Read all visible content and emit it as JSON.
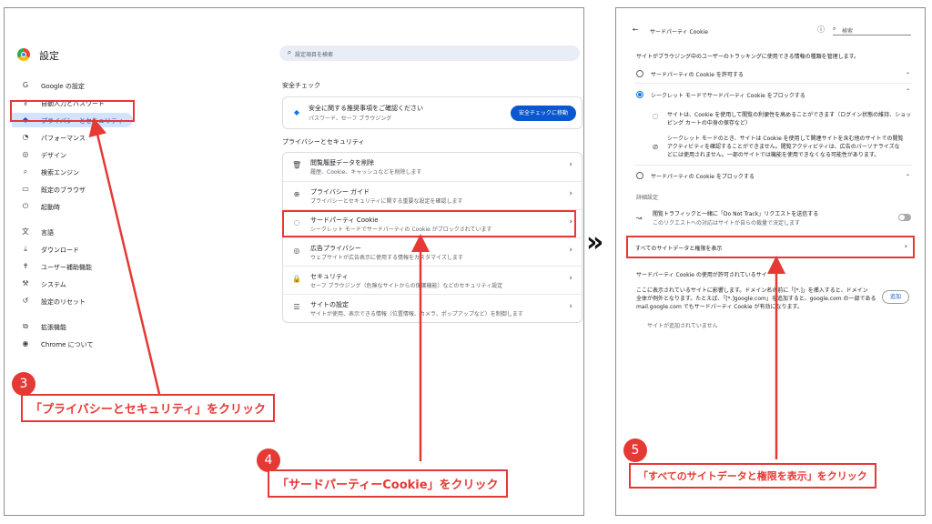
{
  "left": {
    "title": "設定",
    "search_placeholder": "設定項目を検索",
    "nav": [
      {
        "label": "Google の設定",
        "icon": "google-icon",
        "glyph": "G"
      },
      {
        "label": "自動入力とパスワード",
        "icon": "key-icon",
        "glyph": "⚷"
      },
      {
        "label": "プライバシーとセキュリティ",
        "icon": "shield-icon",
        "glyph": "◆"
      },
      {
        "label": "パフォーマンス",
        "icon": "gauge-icon",
        "glyph": "◔"
      },
      {
        "label": "デザイン",
        "icon": "palette-icon",
        "glyph": "◎"
      },
      {
        "label": "検索エンジン",
        "icon": "search-icon",
        "glyph": "⌕"
      },
      {
        "label": "既定のブラウザ",
        "icon": "browser-icon",
        "glyph": "▭"
      },
      {
        "label": "起動時",
        "icon": "power-icon",
        "glyph": "⏻"
      },
      {
        "label": "言語",
        "icon": "translate-icon",
        "glyph": "文"
      },
      {
        "label": "ダウンロード",
        "icon": "download-icon",
        "glyph": "⤓"
      },
      {
        "label": "ユーザー補助機能",
        "icon": "accessibility-icon",
        "glyph": "✝"
      },
      {
        "label": "システム",
        "icon": "wrench-icon",
        "glyph": "⚒"
      },
      {
        "label": "設定のリセット",
        "icon": "reset-icon",
        "glyph": "↺"
      },
      {
        "label": "拡張機能",
        "icon": "extension-icon",
        "glyph": "⧉"
      },
      {
        "label": "Chrome について",
        "icon": "chrome-icon",
        "glyph": "◉"
      }
    ],
    "safety_heading": "安全チェック",
    "safety_text1": "安全に関する推奨事項をご確認ください",
    "safety_text2": "パスワード、セーフ ブラウジング",
    "safety_button": "安全チェックに移動",
    "privacy_heading": "プライバシーとセキュリティ",
    "privacy_rows": [
      {
        "title": "閲覧履歴データを削除",
        "desc": "履歴、Cookie、キャッシュなどを削除します",
        "icon": "trash-icon",
        "glyph": "🗑"
      },
      {
        "title": "プライバシー ガイド",
        "desc": "プライバシーとセキュリティに関する重要な設定を確認します",
        "icon": "guide-icon",
        "glyph": "⊕"
      },
      {
        "title": "サードパーティ Cookie",
        "desc": "シークレット モードでサードパーティの Cookie がブロックされています",
        "icon": "cookie-icon",
        "glyph": "◌"
      },
      {
        "title": "広告プライバシー",
        "desc": "ウェブサイトが広告表示に使用する情報をカスタマイズします",
        "icon": "ad-icon",
        "glyph": "◎"
      },
      {
        "title": "セキュリティ",
        "desc": "セーフ ブラウジング（危険なサイトからの保護機能）などのセキュリティ設定",
        "icon": "lock-icon",
        "glyph": "🔒"
      },
      {
        "title": "サイトの設定",
        "desc": "サイトが使用、表示できる情報（位置情報、カメラ、ポップアップなど）を制御します",
        "icon": "sliders-icon",
        "glyph": "☰"
      }
    ]
  },
  "callouts": {
    "c3_num": "3",
    "c3_text": "「プライバシーとセキュリティ」をクリック",
    "c4_num": "4",
    "c4_text": "「サードパーティーCookie」をクリック",
    "c5_num": "5",
    "c5_text": "「すべてのサイトデータと権限を表示」をクリック",
    "arrow": "»"
  },
  "right": {
    "title": "サードパーティ Cookie",
    "search_placeholder": "検索",
    "intro": "サイトがブラウジング中のユーザーのトラッキングに使用できる情報の種類を管理します。",
    "opt1": "サードパーティの Cookie を許可する",
    "opt2": "シークレット モードでサードパーティ Cookie をブロックする",
    "opt2_b1a": "サイトは、Cookie を使用して閲覧の利便性を高めることができます（ログイン状態の維持、ショッ",
    "opt2_b1b": "ピング カートの中身の保存など）",
    "opt2_b2a": "シークレット モードのとき、サイトは Cookie を使用して関連サイトを含む他のサイトでの閲覧",
    "opt2_b2b": "アクティビティを確認することができません。閲覧アクティビティは、広告のパーソナライズな",
    "opt2_b2c": "どには使用されません。一部のサイトでは機能を使用できなくなる可能性があります。",
    "opt3": "サードパーティの Cookie をブロックする",
    "advanced": "詳細設定",
    "dnt1": "閲覧トラフィックと一緒に「Do Not Track」リクエストを送信する",
    "dnt2": "このリクエストへの対応はサイトが自らの裁量で決定します",
    "all_sites": "すべてのサイトデータと権限を表示",
    "allowed_heading": "サードパーティ Cookie の使用が許可されているサイ",
    "allowed_d1": "ここに表示されているサイトに影響します。ドメイン名の前に「[*.]」を挿入すると、ドメイン",
    "allowed_d2": "全体が例外となります。たとえば、「[*.]google.com」を追加すると、google.com の一部である",
    "allowed_d3": "mail.google.com でもサードパーティ Cookie が有効になります。",
    "add_button": "追加",
    "no_sites": "サイトが追加されていません"
  }
}
